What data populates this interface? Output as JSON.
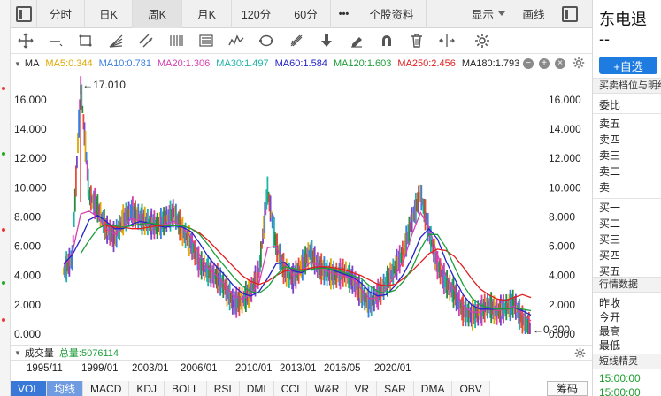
{
  "tabs": [
    {
      "label": "",
      "icon": "panel-toggle-icon",
      "active": false
    },
    {
      "label": "分时",
      "active": false
    },
    {
      "label": "日K",
      "active": false
    },
    {
      "label": "周K",
      "active": true
    },
    {
      "label": "月K",
      "active": false
    },
    {
      "label": "120分",
      "active": false
    },
    {
      "label": "60分",
      "active": false
    },
    {
      "label": "•••",
      "active": false
    },
    {
      "label": "个股资料",
      "active": false
    },
    {
      "label": "显示",
      "active": false,
      "dropdown": true
    },
    {
      "label": "画线",
      "active": false
    },
    {
      "label": "",
      "icon": "panel-toggle-icon",
      "active": false
    }
  ],
  "toolbar": {
    "tools": [
      "crosshair-icon",
      "line-segment-icon",
      "rectangle-icon",
      "fan-icon",
      "parallel-line-icon",
      "fibonacci-icon",
      "text-lines-icon",
      "wave-icon",
      "cycle-icon",
      "pitchfork-icon",
      "arrow-down-icon",
      "eraser-icon",
      "magnet-icon",
      "trash-icon",
      "expand-icon",
      "settings-icon"
    ]
  },
  "ma_legend": {
    "prefix": "MA",
    "items": [
      {
        "label": "MA5:0.344",
        "color": "#e0a800"
      },
      {
        "label": "MA10:0.781",
        "color": "#3a7fe0"
      },
      {
        "label": "MA20:1.306",
        "color": "#d63fb0"
      },
      {
        "label": "MA30:1.497",
        "color": "#1fb4a8"
      },
      {
        "label": "MA60:1.584",
        "color": "#2323c8"
      },
      {
        "label": "MA120:1.603",
        "color": "#1d9e3a"
      },
      {
        "label": "MA250:2.456",
        "color": "#e01e1e"
      },
      {
        "label": "MA180:1.793",
        "color": "#222222"
      }
    ]
  },
  "chart_data": {
    "type": "line",
    "title": "",
    "ylim": [
      0,
      17.5
    ],
    "y_ticks": [
      "16.000",
      "14.000",
      "12.000",
      "10.000",
      "8.000",
      "6.000",
      "4.000",
      "2.000",
      "0.000"
    ],
    "x_tick_labels": [
      "1995/11",
      "1999/01",
      "2003/01",
      "2006/01",
      "2010/01",
      "2013/01",
      "2016/05",
      "2020/01"
    ],
    "annotations": [
      {
        "text": "17.010",
        "value": 17.01,
        "kind": "max"
      },
      {
        "text": "0.300",
        "value": 0.3,
        "kind": "min"
      }
    ],
    "series": [
      {
        "name": "Price",
        "color": "#c0392b",
        "values": [
          4.3,
          5.2,
          17.0,
          9.5,
          8.6,
          7.2,
          6.6,
          7.8,
          8.4,
          7.9,
          7.6,
          7.4,
          7.8,
          8.3,
          7.0,
          6.2,
          4.8,
          4.3,
          3.9,
          3.2,
          2.1,
          2.3,
          2.9,
          4.2,
          9.8,
          6.1,
          4.3,
          3.8,
          4.6,
          5.6,
          4.6,
          4.2,
          4.0,
          4.2,
          3.7,
          2.8,
          2.1,
          2.7,
          3.5,
          4.5,
          5.6,
          7.8,
          9.6,
          7.0,
          4.7,
          3.5,
          2.8,
          1.6,
          1.3,
          1.5,
          2.0,
          1.5,
          1.8,
          2.1,
          1.0,
          0.3
        ]
      },
      {
        "name": "MA20",
        "color": "#d63fb0",
        "values": [
          4.6,
          5.5,
          8.2,
          8.4,
          8.0,
          7.2,
          6.8,
          7.3,
          7.9,
          7.7,
          7.5,
          7.4,
          7.5,
          7.7,
          7.3,
          6.6,
          5.4,
          4.5,
          4.0,
          3.4,
          2.6,
          2.4,
          2.7,
          3.5,
          5.9,
          6.0,
          4.8,
          4.0,
          4.2,
          4.9,
          4.7,
          4.3,
          4.1,
          4.0,
          3.8,
          3.1,
          2.4,
          2.5,
          3.1,
          4.0,
          5.0,
          6.8,
          8.3,
          7.3,
          5.4,
          4.0,
          3.0,
          2.0,
          1.5,
          1.5,
          1.8,
          1.6,
          1.7,
          1.9,
          1.4,
          0.9
        ]
      },
      {
        "name": "MA60",
        "color": "#2323c8",
        "values": [
          4.8,
          5.4,
          6.5,
          7.8,
          8.1,
          7.7,
          7.2,
          7.2,
          7.5,
          7.7,
          7.6,
          7.4,
          7.3,
          7.4,
          7.3,
          7.0,
          6.2,
          5.3,
          4.6,
          4.0,
          3.3,
          2.8,
          2.6,
          2.9,
          3.8,
          4.8,
          4.9,
          4.3,
          4.2,
          4.5,
          4.6,
          4.5,
          4.3,
          4.1,
          3.9,
          3.5,
          2.9,
          2.6,
          2.7,
          3.3,
          4.1,
          5.2,
          6.6,
          7.2,
          6.5,
          5.0,
          3.8,
          2.7,
          2.0,
          1.7,
          1.7,
          1.7,
          1.7,
          1.8,
          1.6,
          1.3
        ]
      },
      {
        "name": "MA250",
        "color": "#e01e1e",
        "values": [
          null,
          null,
          null,
          null,
          null,
          7.4,
          7.3,
          7.3,
          7.2,
          7.2,
          7.3,
          7.4,
          7.4,
          7.4,
          7.4,
          7.2,
          6.9,
          6.4,
          5.8,
          5.2,
          4.6,
          4.0,
          3.6,
          3.4,
          3.6,
          4.0,
          4.3,
          4.4,
          4.4,
          4.5,
          4.6,
          4.6,
          4.5,
          4.4,
          4.2,
          4.0,
          3.7,
          3.4,
          3.3,
          3.4,
          3.8,
          4.3,
          4.9,
          5.5,
          5.8,
          5.7,
          5.3,
          4.6,
          3.8,
          3.1,
          2.7,
          2.4,
          2.3,
          2.5,
          2.7,
          2.5
        ]
      },
      {
        "name": "MA120",
        "color": "#1d9e3a",
        "values": [
          null,
          null,
          5.5,
          6.4,
          7.2,
          7.5,
          7.4,
          7.3,
          7.4,
          7.5,
          7.6,
          7.5,
          7.4,
          7.4,
          7.4,
          7.2,
          6.8,
          6.1,
          5.3,
          4.6,
          3.9,
          3.3,
          2.9,
          2.8,
          3.2,
          4.0,
          4.6,
          4.5,
          4.3,
          4.4,
          4.5,
          4.5,
          4.4,
          4.2,
          4.0,
          3.8,
          3.3,
          2.9,
          2.8,
          3.0,
          3.6,
          4.5,
          5.8,
          6.8,
          6.8,
          5.9,
          4.6,
          3.4,
          2.5,
          2.0,
          1.8,
          1.7,
          1.7,
          1.8,
          1.7,
          1.6
        ]
      }
    ],
    "grid": false,
    "legend": "top-left"
  },
  "volume_bar": {
    "label": "成交量",
    "total_label": "总量:5076114",
    "total_color": "#1d9e3a"
  },
  "indicator_tabs": [
    {
      "label": "VOL",
      "state": "active"
    },
    {
      "label": "均线",
      "state": "secondary"
    },
    {
      "label": "MACD",
      "state": "normal"
    },
    {
      "label": "KDJ",
      "state": "normal"
    },
    {
      "label": "BOLL",
      "state": "normal"
    },
    {
      "label": "RSI",
      "state": "normal"
    },
    {
      "label": "DMI",
      "state": "normal"
    },
    {
      "label": "CCI",
      "state": "normal"
    },
    {
      "label": "W&R",
      "state": "normal"
    },
    {
      "label": "VR",
      "state": "normal"
    },
    {
      "label": "SAR",
      "state": "normal"
    },
    {
      "label": "DMA",
      "state": "normal"
    },
    {
      "label": "OBV",
      "state": "normal"
    }
  ],
  "chips_button": "筹码",
  "right_panel": {
    "stock_name": "东电退",
    "stock_value": "--",
    "add_button": "+自选",
    "orderbook_title": "买卖档位与明细",
    "ratio_label": "委比",
    "sells": [
      "卖五",
      "卖四",
      "卖三",
      "卖二",
      "卖一"
    ],
    "buys": [
      "买一",
      "买二",
      "买三",
      "买四",
      "买五"
    ],
    "quote_title": "行情数据",
    "quote_rows": [
      "昨收",
      "今开",
      "最高",
      "最低"
    ],
    "brief_title": "短线精灵",
    "times": [
      "15:00:00",
      "15:00:00"
    ]
  }
}
